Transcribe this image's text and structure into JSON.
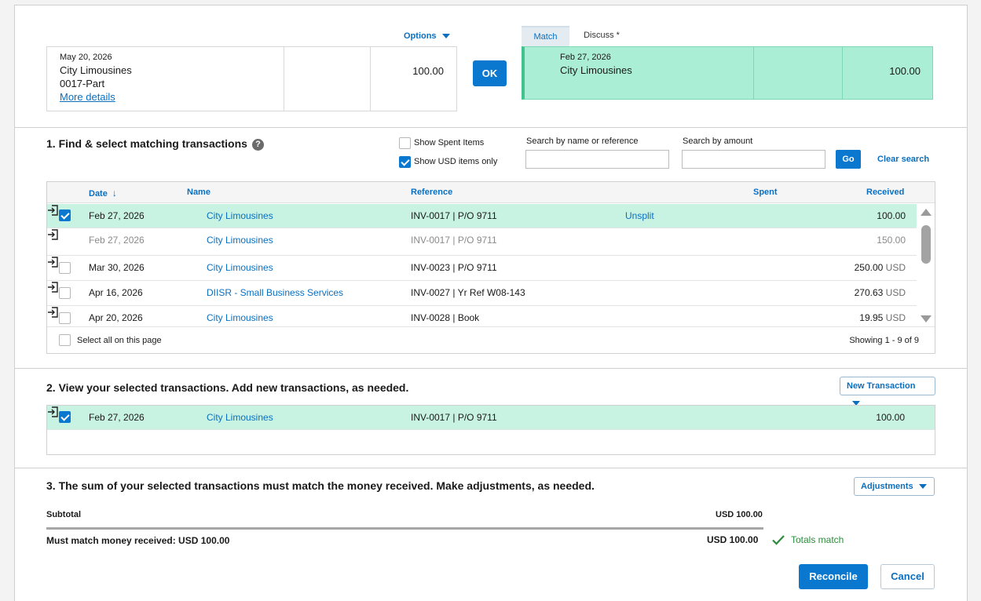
{
  "statement": {
    "date": "May 20, 2026",
    "payee": "City Limousines",
    "reference": "0017-Part",
    "more_link": "More details",
    "amount": "100.00"
  },
  "options_label": "Options",
  "ok_label": "OK",
  "tabs": [
    {
      "label": "Match",
      "active": true
    },
    {
      "label": "Discuss *",
      "active": false
    }
  ],
  "matched": {
    "date": "Feb 27, 2026",
    "payee": "City Limousines",
    "amount": "100.00"
  },
  "section1": {
    "title": "1. Find & select matching transactions",
    "show_spent_label": "Show Spent Items",
    "show_spent_checked": false,
    "show_usd_label": "Show USD items only",
    "show_usd_checked": true,
    "search_name_label": "Search by name or reference",
    "search_name_value": "",
    "search_amount_label": "Search by amount",
    "search_amount_value": "",
    "go_label": "Go",
    "clear_label": "Clear search",
    "columns": {
      "date": "Date",
      "name": "Name",
      "reference": "Reference",
      "spent": "Spent",
      "received": "Received"
    },
    "rows": [
      {
        "checked": true,
        "date": "Feb 27, 2026",
        "name": "City Limousines",
        "reference": "INV-0017 | P/O 9711",
        "action": "Unsplit",
        "amount": "100.00",
        "currency": "",
        "state": "selected"
      },
      {
        "checked": null,
        "date": "Feb 27, 2026",
        "name": "City Limousines",
        "reference": "INV-0017 | P/O 9711",
        "action": "",
        "amount": "150.00",
        "currency": "",
        "state": "dim"
      },
      {
        "checked": false,
        "date": "Mar 30, 2026",
        "name": "City Limousines",
        "reference": "INV-0023 | P/O 9711",
        "action": "",
        "amount": "250.00",
        "currency": "USD",
        "state": "normal"
      },
      {
        "checked": false,
        "date": "Apr 16, 2026",
        "name": "DIISR - Small Business Services",
        "reference": "INV-0027 | Yr Ref W08-143",
        "action": "",
        "amount": "270.63",
        "currency": "USD",
        "state": "normal"
      },
      {
        "checked": false,
        "date": "Apr 20, 2026",
        "name": "City Limousines",
        "reference": "INV-0028 | Book",
        "action": "",
        "amount": "19.95",
        "currency": "USD",
        "state": "normal"
      }
    ],
    "select_all_label": "Select all on this page",
    "showing": "Showing 1 - 9 of 9"
  },
  "section2": {
    "title": "2. View your selected transactions. Add new transactions, as needed.",
    "new_transaction_label": "New Transaction",
    "rows": [
      {
        "checked": true,
        "date": "Feb 27, 2026",
        "name": "City Limousines",
        "reference": "INV-0017 | P/O 9711",
        "amount": "100.00"
      }
    ]
  },
  "section3": {
    "title": "3. The sum of your selected transactions must match the money received. Make adjustments, as needed.",
    "adjustments_label": "Adjustments",
    "subtotal_label": "Subtotal",
    "subtotal_value": "USD 100.00",
    "must_match_label": "Must match money received: USD 100.00",
    "total_value": "USD 100.00",
    "status": "Totals match"
  },
  "actions": {
    "reconcile": "Reconcile",
    "cancel": "Cancel"
  },
  "colors": {
    "accent": "#0b78d0",
    "match_bg": "#aaeed5",
    "selected_row": "#c8f2e2",
    "ok_green": "#2e8b3d"
  }
}
